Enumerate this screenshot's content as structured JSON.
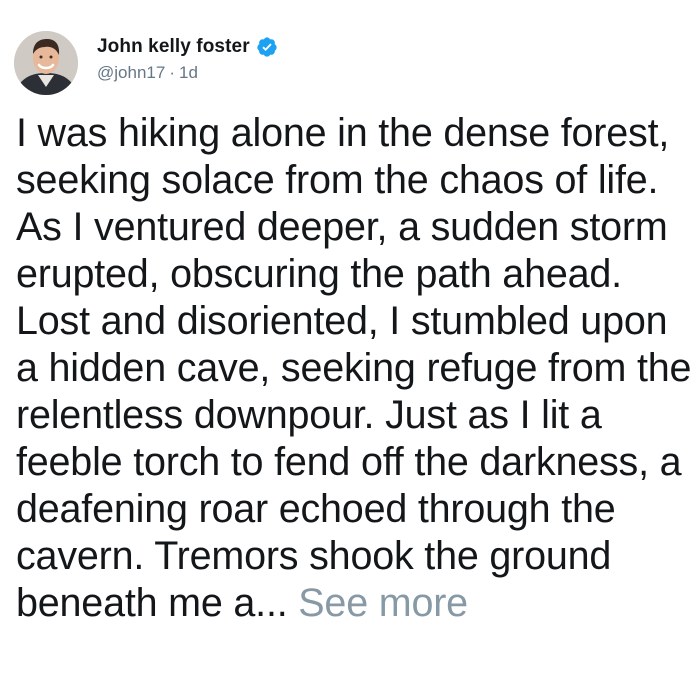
{
  "tweet": {
    "author_name": "John kelly foster",
    "verified": true,
    "handle": "@john17",
    "separator": "·",
    "time_ago": "1d",
    "text": "I was hiking alone in the dense forest, seeking solace from the chaos of life. As I ventured deeper, a sudden storm erupted, obscuring the path ahead. Lost and disoriented, I stumbled upon a hidden cave, seeking refuge from the relentless downpour. Just as I lit a feeble torch to fend off the darkness, a deafening roar echoed through the cavern. Tremors shook the ground beneath me a...",
    "see_more_label": "See more"
  },
  "icons": {
    "avatar": "user-avatar",
    "verified": "verified-badge-icon"
  },
  "colors": {
    "text": "#14171a",
    "secondary": "#657786",
    "see_more": "#8899a6",
    "verified": "#1da1f2"
  }
}
